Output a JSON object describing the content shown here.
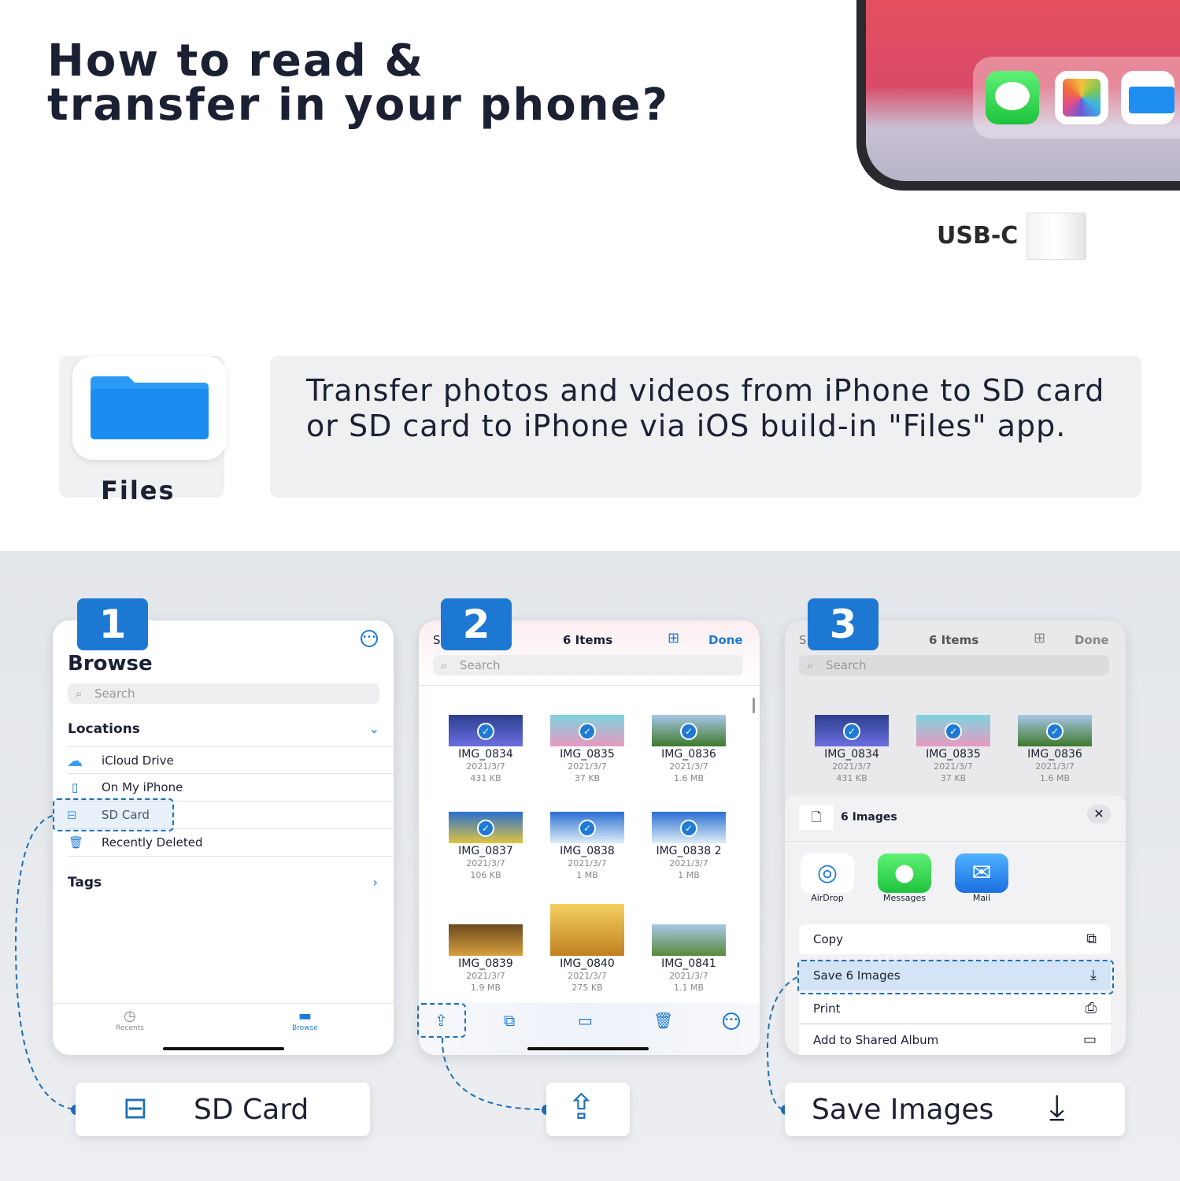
{
  "header": {
    "title_line1": "How to read &",
    "title_line2": "transfer in your phone?"
  },
  "device": {
    "connector_label": "USB-C",
    "dock_apps": [
      "Messages",
      "Photos",
      "Files"
    ]
  },
  "intro": {
    "app_name": "Files",
    "description": "Transfer photos and videos from iPhone to SD card or SD card to iPhone via iOS build-in \"Files\" app."
  },
  "colors": {
    "accent": "#1d78d4",
    "text": "#1b2033",
    "section_bg": "#e3e6ea"
  },
  "step1": {
    "number": "1",
    "title": "Browse",
    "search_placeholder": "Search",
    "locations_label": "Locations",
    "tags_label": "Tags",
    "locations": [
      {
        "label": "iCloud Drive",
        "icon": "cloud-icon"
      },
      {
        "label": "On My iPhone",
        "icon": "phone-icon"
      },
      {
        "label": "SD Card",
        "icon": "drive-icon"
      },
      {
        "label": "Recently Deleted",
        "icon": "trash-icon"
      }
    ],
    "tabs": [
      {
        "label": "Recents"
      },
      {
        "label": "Browse"
      }
    ],
    "callout": "SD Card"
  },
  "step2": {
    "number": "2",
    "select_partial": "S",
    "header": "6 Items",
    "done": "Done",
    "search_placeholder": "Search",
    "files": [
      {
        "name": "IMG_0834",
        "date": "2021/3/7",
        "size": "431 KB",
        "selected": true
      },
      {
        "name": "IMG_0835",
        "date": "2021/3/7",
        "size": "37 KB",
        "selected": true
      },
      {
        "name": "IMG_0836",
        "date": "2021/3/7",
        "size": "1.6 MB",
        "selected": true
      },
      {
        "name": "IMG_0837",
        "date": "2021/3/7",
        "size": "106 KB",
        "selected": true
      },
      {
        "name": "IMG_0838",
        "date": "2021/3/7",
        "size": "1 MB",
        "selected": true
      },
      {
        "name": "IMG_0838 2",
        "date": "2021/3/7",
        "size": "1 MB",
        "selected": true
      },
      {
        "name": "IMG_0839",
        "date": "2021/3/7",
        "size": "1.9 MB",
        "selected": false
      },
      {
        "name": "IMG_0840",
        "date": "2021/3/7",
        "size": "275 KB",
        "selected": false
      },
      {
        "name": "IMG_0841",
        "date": "2021/3/7",
        "size": "1.1 MB",
        "selected": false
      }
    ]
  },
  "step3": {
    "number": "3",
    "select_partial": "S",
    "header": "6 Items",
    "done": "Done",
    "search_placeholder": "Search",
    "sheet_title": "6 Images",
    "share_apps": [
      {
        "label": "AirDrop"
      },
      {
        "label": "Messages"
      },
      {
        "label": "Mail"
      }
    ],
    "actions": [
      {
        "label": "Copy",
        "icon": "copy-icon"
      },
      {
        "label": "Save 6 Images",
        "icon": "save-icon"
      },
      {
        "label": "Print",
        "icon": "print-icon"
      },
      {
        "label": "Add to Shared Album",
        "icon": "shared-album-icon"
      }
    ],
    "callout": "Save Images"
  }
}
